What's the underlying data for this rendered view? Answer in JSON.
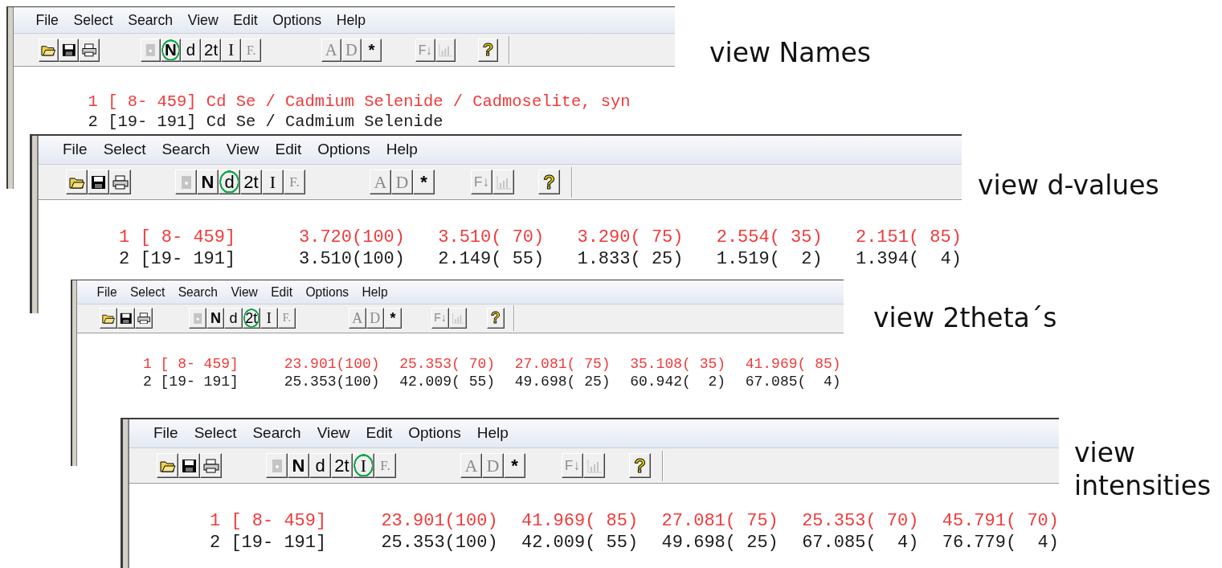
{
  "windows": [
    {
      "kind": "names",
      "menu": [
        "File",
        "Select",
        "Search",
        "View",
        "Edit",
        "Options",
        "Help"
      ],
      "toolbar": [
        [
          {
            "kind": "icon",
            "disabled": false,
            "selected": false
          },
          {
            "kind": "icon",
            "disabled": false,
            "selected": false
          },
          {
            "kind": "icon",
            "disabled": false,
            "selected": false
          }
        ],
        [
          {
            "kind": "icon",
            "disabled": true,
            "selected": false
          },
          {
            "kind": "text",
            "label": "N",
            "disabled": false,
            "selected": true
          },
          {
            "kind": "text",
            "label": "d",
            "disabled": false,
            "selected": false
          },
          {
            "kind": "text",
            "label": "2t",
            "disabled": false,
            "selected": false
          },
          {
            "kind": "text",
            "label": "I",
            "disabled": false,
            "selected": false
          },
          {
            "kind": "text",
            "label": "F.",
            "disabled": true,
            "selected": false
          }
        ],
        [
          {
            "kind": "text",
            "label": "A",
            "disabled": true,
            "selected": false
          },
          {
            "kind": "text",
            "label": "D",
            "disabled": true,
            "selected": false
          },
          {
            "kind": "text",
            "label": "*",
            "disabled": false,
            "selected": false
          }
        ],
        [
          {
            "kind": "text",
            "label": "F↓",
            "disabled": true,
            "selected": false
          },
          {
            "kind": "icon",
            "disabled": true,
            "selected": false
          }
        ],
        [
          {
            "kind": "text",
            "label": "?",
            "disabled": false,
            "selected": false
          }
        ]
      ],
      "rows": [
        {
          "number": "1",
          "ref": "[ 8- 459]",
          "cells": [
            "Cd Se / Cadmium Selenide / Cadmoselite, syn"
          ],
          "color": "#f03a3a"
        },
        {
          "number": "2",
          "ref": "[19- 191]",
          "cells": [
            "Cd Se / Cadmium Selenide"
          ],
          "color": "#1a1a1a"
        }
      ]
    },
    {
      "kind": "peaks",
      "menu": [
        "File",
        "Select",
        "Search",
        "View",
        "Edit",
        "Options",
        "Help"
      ],
      "toolbar": [
        [
          {
            "kind": "icon",
            "disabled": false,
            "selected": false
          },
          {
            "kind": "icon",
            "disabled": false,
            "selected": false
          },
          {
            "kind": "icon",
            "disabled": false,
            "selected": false
          }
        ],
        [
          {
            "kind": "icon",
            "disabled": true,
            "selected": false
          },
          {
            "kind": "text",
            "label": "N",
            "disabled": false,
            "selected": false
          },
          {
            "kind": "text",
            "label": "d",
            "disabled": false,
            "selected": true
          },
          {
            "kind": "text",
            "label": "2t",
            "disabled": false,
            "selected": false
          },
          {
            "kind": "text",
            "label": "I",
            "disabled": false,
            "selected": false
          },
          {
            "kind": "text",
            "label": "F.",
            "disabled": true,
            "selected": false
          }
        ],
        [
          {
            "kind": "text",
            "label": "A",
            "disabled": true,
            "selected": false
          },
          {
            "kind": "text",
            "label": "D",
            "disabled": true,
            "selected": false
          },
          {
            "kind": "text",
            "label": "*",
            "disabled": false,
            "selected": false
          }
        ],
        [
          {
            "kind": "text",
            "label": "F↓",
            "disabled": true,
            "selected": false
          },
          {
            "kind": "icon",
            "disabled": true,
            "selected": false
          }
        ],
        [
          {
            "kind": "text",
            "label": "?",
            "disabled": false,
            "selected": false
          }
        ]
      ],
      "rows": [
        {
          "number": "1",
          "ref": "[ 8- 459]",
          "cells": [
            "3.720(100)",
            "3.510( 70)",
            "3.290( 75)",
            "2.554( 35)",
            "2.151( 85)"
          ],
          "color": "#f03a3a"
        },
        {
          "number": "2",
          "ref": "[19- 191]",
          "cells": [
            "3.510(100)",
            "2.149( 55)",
            "1.833( 25)",
            "1.519(  2)",
            "1.394(  4)"
          ],
          "color": "#1a1a1a"
        }
      ]
    },
    {
      "kind": "peaks",
      "menu": [
        "File",
        "Select",
        "Search",
        "View",
        "Edit",
        "Options",
        "Help"
      ],
      "toolbar": [
        [
          {
            "kind": "icon",
            "disabled": false,
            "selected": false
          },
          {
            "kind": "icon",
            "disabled": false,
            "selected": false
          },
          {
            "kind": "icon",
            "disabled": false,
            "selected": false
          }
        ],
        [
          {
            "kind": "icon",
            "disabled": true,
            "selected": false
          },
          {
            "kind": "text",
            "label": "N",
            "disabled": false,
            "selected": false
          },
          {
            "kind": "text",
            "label": "d",
            "disabled": false,
            "selected": false
          },
          {
            "kind": "text",
            "label": "2t",
            "disabled": false,
            "selected": true
          },
          {
            "kind": "text",
            "label": "I",
            "disabled": false,
            "selected": false
          },
          {
            "kind": "text",
            "label": "F.",
            "disabled": true,
            "selected": false
          }
        ],
        [
          {
            "kind": "text",
            "label": "A",
            "disabled": true,
            "selected": false
          },
          {
            "kind": "text",
            "label": "D",
            "disabled": true,
            "selected": false
          },
          {
            "kind": "text",
            "label": "*",
            "disabled": false,
            "selected": false
          }
        ],
        [
          {
            "kind": "text",
            "label": "F↓",
            "disabled": true,
            "selected": false
          },
          {
            "kind": "icon",
            "disabled": true,
            "selected": false
          }
        ],
        [
          {
            "kind": "text",
            "label": "?",
            "disabled": false,
            "selected": false
          }
        ]
      ],
      "rows": [
        {
          "number": "1",
          "ref": "[ 8- 459]",
          "cells": [
            "23.901(100)",
            "25.353( 70)",
            "27.081( 75)",
            "35.108( 35)",
            "41.969( 85)"
          ],
          "color": "#f03a3a"
        },
        {
          "number": "2",
          "ref": "[19- 191]",
          "cells": [
            "25.353(100)",
            "42.009( 55)",
            "49.698( 25)",
            "60.942(  2)",
            "67.085(  4)"
          ],
          "color": "#1a1a1a"
        }
      ]
    },
    {
      "kind": "peaks",
      "menu": [
        "File",
        "Select",
        "Search",
        "View",
        "Edit",
        "Options",
        "Help"
      ],
      "toolbar": [
        [
          {
            "kind": "icon",
            "disabled": false,
            "selected": false
          },
          {
            "kind": "icon",
            "disabled": false,
            "selected": false
          },
          {
            "kind": "icon",
            "disabled": false,
            "selected": false
          }
        ],
        [
          {
            "kind": "icon",
            "disabled": true,
            "selected": false
          },
          {
            "kind": "text",
            "label": "N",
            "disabled": false,
            "selected": false
          },
          {
            "kind": "text",
            "label": "d",
            "disabled": false,
            "selected": false
          },
          {
            "kind": "text",
            "label": "2t",
            "disabled": false,
            "selected": false
          },
          {
            "kind": "text",
            "label": "I",
            "disabled": false,
            "selected": true
          },
          {
            "kind": "text",
            "label": "F.",
            "disabled": true,
            "selected": false
          }
        ],
        [
          {
            "kind": "text",
            "label": "A",
            "disabled": true,
            "selected": false
          },
          {
            "kind": "text",
            "label": "D",
            "disabled": true,
            "selected": false
          },
          {
            "kind": "text",
            "label": "*",
            "disabled": false,
            "selected": false
          }
        ],
        [
          {
            "kind": "text",
            "label": "F↓",
            "disabled": true,
            "selected": false
          },
          {
            "kind": "icon",
            "disabled": true,
            "selected": false
          }
        ],
        [
          {
            "kind": "text",
            "label": "?",
            "disabled": false,
            "selected": false
          }
        ]
      ],
      "rows": [
        {
          "number": "1",
          "ref": "[ 8- 459]",
          "cells": [
            "23.901(100)",
            "41.969( 85)",
            "27.081( 75)",
            "25.353( 70)",
            "45.791( 70)"
          ],
          "color": "#f03a3a"
        },
        {
          "number": "2",
          "ref": "[19- 191]",
          "cells": [
            "25.353(100)",
            "42.009( 55)",
            "49.698( 25)",
            "67.085(  4)",
            "76.779(  4)"
          ],
          "color": "#1a1a1a"
        }
      ]
    }
  ],
  "captions": [
    "view Names",
    "view d-values",
    "view 2theta´s",
    "view intensities"
  ]
}
